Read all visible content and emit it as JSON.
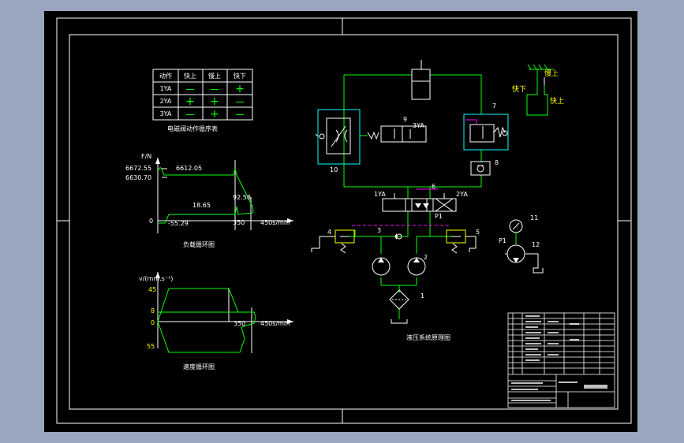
{
  "table": {
    "caption": "电磁阀动作循序表",
    "headers": [
      "动作",
      "快上",
      "慢上",
      "快下"
    ],
    "rows": [
      {
        "name": "1YA",
        "cells": [
          "—",
          "—",
          "+"
        ]
      },
      {
        "name": "2YA",
        "cells": [
          "+",
          "+",
          "—"
        ]
      },
      {
        "name": "3YA",
        "cells": [
          "—",
          "+",
          "—"
        ]
      }
    ]
  },
  "load_chart": {
    "title": "负载循环图",
    "ylabel": "F/N",
    "v1": "6672.55",
    "v2": "6630.70",
    "v3": "6612.05",
    "v4": "18.65",
    "v5": "92.58",
    "v6": "-55.29",
    "zero": "0",
    "x1": "350",
    "x2": "450s/mm"
  },
  "speed_chart": {
    "title": "速度循环图",
    "ylabel": "v/(mm.s⁻¹)",
    "v1": "45",
    "v2": "8",
    "zero": "0",
    "v3": "55",
    "x1": "350",
    "x2": "450s/mm"
  },
  "schematic": {
    "title": "液压系统原理图",
    "labels": {
      "n1": "1",
      "n2": "2",
      "n3": "3",
      "n4": "4",
      "n5": "5",
      "n6": "6",
      "n7": "7",
      "n8": "8",
      "n9": "9",
      "n10": "10",
      "n11": "11",
      "n12": "12",
      "ya1": "1YA",
      "ya2": "2YA",
      "ya3": "3YA",
      "p1a": "P1",
      "p1b": "P1"
    }
  },
  "motion": {
    "slow_up": "慢上",
    "fast_down": "快下",
    "fast_up": "快上"
  },
  "colors": {
    "background": "#000000",
    "frame": "#ffffff",
    "line": "#00ff00",
    "table": "#00ff00",
    "symbol": "#ffffff",
    "cyan": "#00ffff",
    "magenta": "#ff00ff",
    "yellow": "#ffff00",
    "outer": "#9aa6bd"
  }
}
